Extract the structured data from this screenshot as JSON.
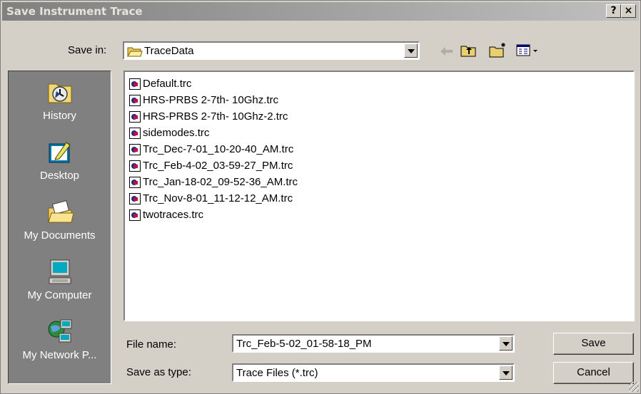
{
  "window": {
    "title": "Save Instrument Trace",
    "help_label": "?",
    "close_label": "×"
  },
  "save_in": {
    "label": "Save in:",
    "value": "TraceData"
  },
  "toolbar": {
    "icons": [
      "back-arrow-icon",
      "up-one-level-icon",
      "create-new-folder-icon",
      "view-menu-icon"
    ]
  },
  "places": [
    {
      "label": "History",
      "icon": "history-icon"
    },
    {
      "label": "Desktop",
      "icon": "desktop-icon"
    },
    {
      "label": "My Documents",
      "icon": "my-documents-icon"
    },
    {
      "label": "My Computer",
      "icon": "my-computer-icon"
    },
    {
      "label": "My Network P...",
      "icon": "my-network-icon"
    }
  ],
  "files": [
    "Default.trc",
    "HRS-PRBS 2-7th- 10Ghz.trc",
    "HRS-PRBS 2-7th- 10Ghz-2.trc",
    "sidemodes.trc",
    "Trc_Dec-7-01_10-20-40_AM.trc",
    "Trc_Feb-4-02_03-59-27_PM.trc",
    "Trc_Jan-18-02_09-52-36_AM.trc",
    "Trc_Nov-8-01_11-12-12_AM.trc",
    "twotraces.trc"
  ],
  "file_name": {
    "label": "File name:",
    "value": "Trc_Feb-5-02_01-58-18_PM"
  },
  "save_as_type": {
    "label": "Save as type:",
    "value": "Trace Files (*.trc)"
  },
  "buttons": {
    "save": "Save",
    "cancel": "Cancel"
  }
}
